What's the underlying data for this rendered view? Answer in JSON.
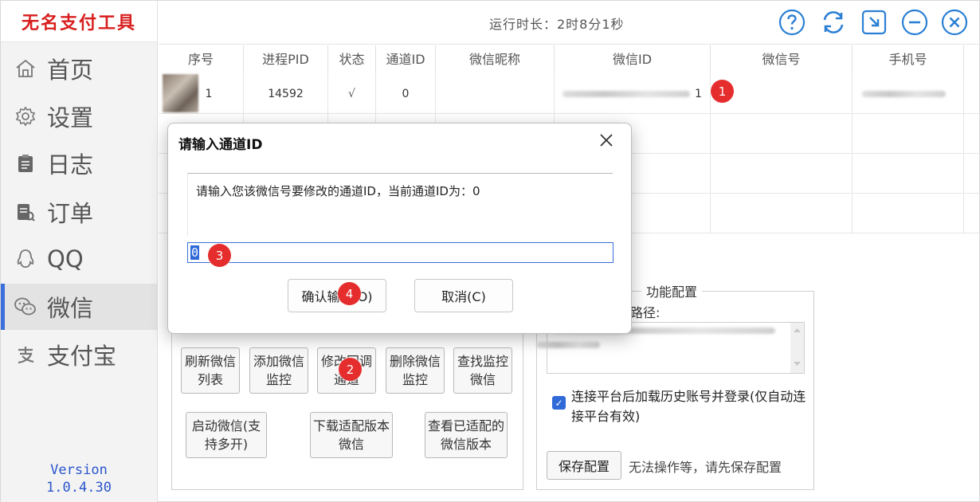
{
  "app": {
    "brand": "无名支付工具",
    "runtime": "运行时长：2时8分1秒",
    "version_line1": "Version",
    "version_line2": "1.0.4.30"
  },
  "sidebar": {
    "items": [
      {
        "label": "首页",
        "icon": "home-icon"
      },
      {
        "label": "设置",
        "icon": "gear-icon"
      },
      {
        "label": "日志",
        "icon": "clipboard-icon"
      },
      {
        "label": "订单",
        "icon": "order-icon"
      },
      {
        "label": "QQ",
        "icon": "qq-icon"
      },
      {
        "label": "微信",
        "icon": "wechat-icon",
        "active": true
      },
      {
        "label": "支付宝",
        "icon": "alipay-icon"
      }
    ]
  },
  "topbar": {
    "icons": [
      "help-icon",
      "refresh-icon",
      "minimize-to-tray-icon",
      "minimize-icon",
      "close-icon"
    ],
    "accent": "#2a7fd4"
  },
  "table": {
    "headers": [
      "序号",
      "进程PID",
      "状态",
      "通道ID",
      "微信昵称",
      "微信ID",
      "微信号",
      "手机号"
    ],
    "rows": [
      {
        "index": "1",
        "pid": "14592",
        "status": "√",
        "channel": "0",
        "nickname": "",
        "wxid_suffix": "1"
      }
    ]
  },
  "actions": {
    "refresh_list": "刷新微信列表",
    "add_monitor": "添加微信监控",
    "modify_callback": "修改回调通道",
    "delete_monitor": "删除微信监控",
    "find_monitor": "查找监控微信",
    "start_wechat": "启动微信(支持多开)",
    "download_wechat": "下载适配版本微信",
    "view_versions": "查看已适配的微信版本"
  },
  "config": {
    "title": "功能配置",
    "path_label": "路径:",
    "checkbox_label": "连接平台后加载历史账号并登录(仅自动连接平台有效)",
    "checkbox_checked": true,
    "save_button": "保存配置",
    "save_hint": "无法操作等，请先保存配置"
  },
  "dialog": {
    "title": "请输入通道ID",
    "message": "请输入您该微信号要修改的通道ID，当前通道ID为：0",
    "input_value": "0",
    "confirm": "确认输入(O)",
    "cancel": "取消(C)"
  },
  "markers": [
    "1",
    "2",
    "3",
    "4"
  ],
  "colors": {
    "brand_red": "#d81e1e",
    "selection_blue": "#2f6ad8",
    "marker_red": "#e52d2d",
    "version_blue": "#2a55cc"
  }
}
